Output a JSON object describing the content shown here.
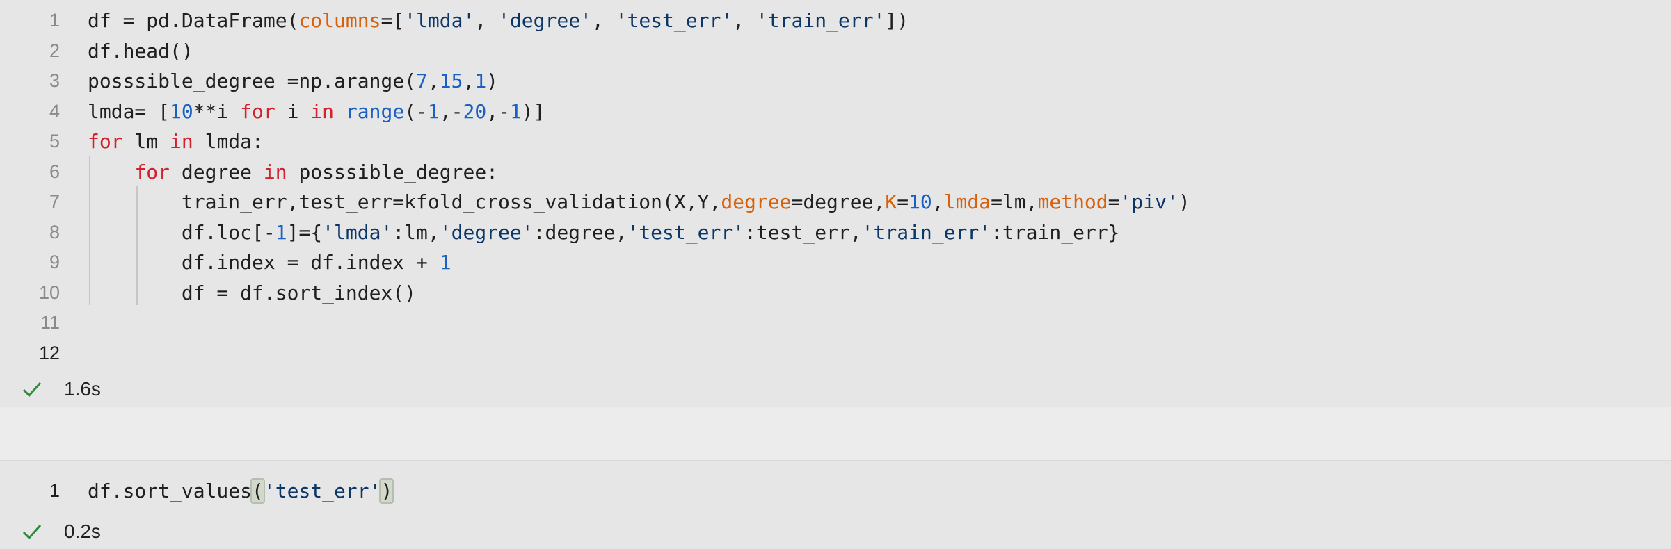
{
  "cell1": {
    "lines": [
      {
        "n": "1",
        "html": "df = pd.DataFrame(<span class=\"arg\">columns</span>=[<span class=\"str\">'lmda'</span>, <span class=\"str\">'degree'</span>, <span class=\"str\">'test_err'</span>, <span class=\"str\">'train_err'</span>])"
      },
      {
        "n": "2",
        "html": "df.head()"
      },
      {
        "n": "3",
        "html": "posssible_degree =np.arange(<span class=\"num\">7</span>,<span class=\"num\">15</span>,<span class=\"num\">1</span>)"
      },
      {
        "n": "4",
        "html": "lmda= [<span class=\"num\">10</span>**i <span class=\"kw\">for</span> i <span class=\"kw\">in</span> <span class=\"num\">range</span>(-<span class=\"num\">1</span>,-<span class=\"num\">20</span>,-<span class=\"num\">1</span>)]"
      },
      {
        "n": "5",
        "html": "<span class=\"kw\">for</span> lm <span class=\"kw\">in</span> lmda:"
      },
      {
        "n": "6",
        "html": "    <span class=\"kw\">for</span> degree <span class=\"kw\">in</span> posssible_degree:"
      },
      {
        "n": "7",
        "html": "        train_err,test_err=kfold_cross_validation(X,Y,<span class=\"arg\">degree</span>=degree,<span class=\"arg\">K</span>=<span class=\"num\">10</span>,<span class=\"arg\">lmda</span>=lm,<span class=\"arg\">method</span>=<span class=\"str\">'piv'</span>)"
      },
      {
        "n": "8",
        "html": "        df.loc[-<span class=\"num\">1</span>]={<span class=\"str\">'lmda'</span>:lm,<span class=\"str\">'degree'</span>:degree,<span class=\"str\">'test_err'</span>:test_err,<span class=\"str\">'train_err'</span>:train_err}"
      },
      {
        "n": "9",
        "html": "        df.index = df.index + <span class=\"num\">1</span>"
      },
      {
        "n": "10",
        "html": "        df = df.sort_index()"
      },
      {
        "n": "11",
        "html": ""
      },
      {
        "n": "12",
        "html": ""
      }
    ],
    "current_line": "12",
    "duration": "1.6s"
  },
  "cell2": {
    "lines": [
      {
        "n": "1",
        "html": "df.sort_values<span class=\"paren-hl\">(</span><span class=\"str\">'test_err'</span><span class=\"paren-hl\">)</span>"
      }
    ],
    "current_line": "1",
    "duration": "0.2s"
  },
  "colors": {
    "keyword": "#d1232e",
    "number": "#1a5fc4",
    "string": "#0b3768",
    "argument": "#d8600a",
    "success_check": "#2e8b3a"
  },
  "icons": {
    "status": "check-icon"
  }
}
